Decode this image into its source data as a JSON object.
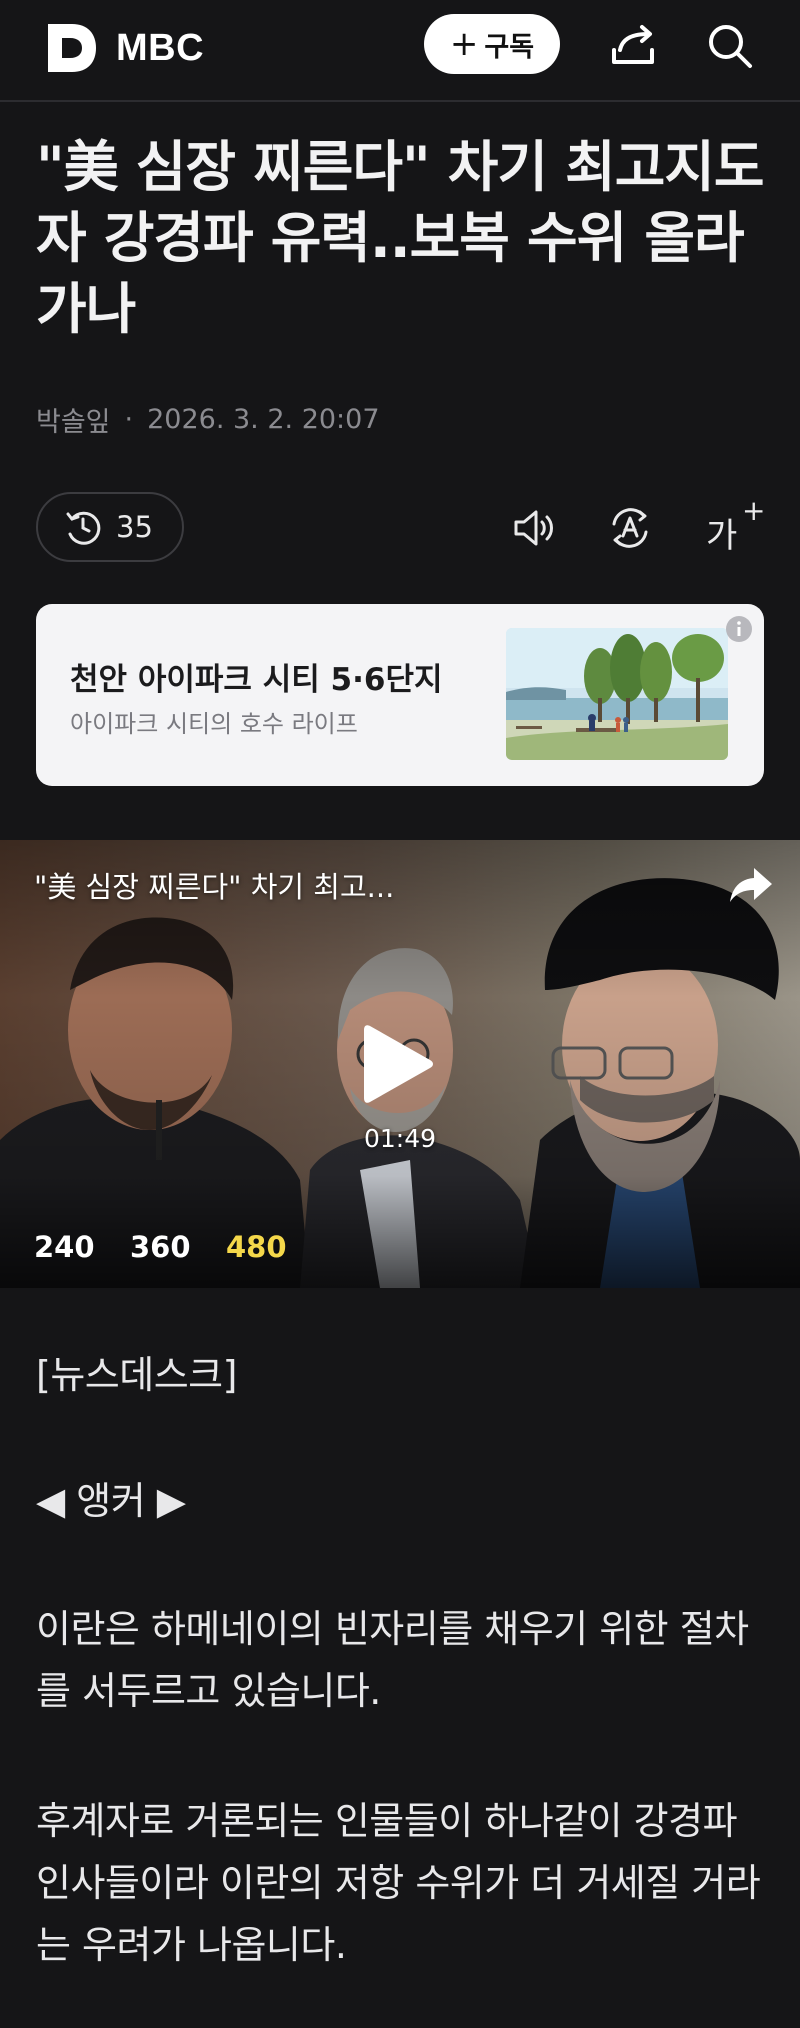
{
  "header": {
    "logo_text": "MBC",
    "subscribe_plus": "+",
    "subscribe_label": "구독",
    "icons": [
      "logo-d-icon",
      "share-icon",
      "search-icon"
    ]
  },
  "article": {
    "headline": "\"美 심장 찌른다\" 차기 최고지도자 강경파 유력..보복 수위 올라가나",
    "author": "박솔잎",
    "separator": "·",
    "datetime": "2026. 3. 2. 20:07",
    "history_count": "35",
    "font_size_label": "가",
    "font_size_plus": "+"
  },
  "ad": {
    "title": "천안 아이파크 시티 5·6단지",
    "subtitle": "아이파크 시티의 호수 라이프",
    "info_icon": "info-icon"
  },
  "video": {
    "title": "\"美 심장 찌른다\" 차기 최고...",
    "duration": "01:49",
    "qualities": [
      "240",
      "360",
      "480"
    ],
    "selected_quality": "480",
    "selected_color": "#f5d84a"
  },
  "body": {
    "tag": "[뉴스데스크]",
    "anchor": "◀ 앵커 ▶",
    "para1": "이란은 하메네이의 빈자리를 채우기 위한 절차를 서두르고 있습니다.",
    "para2": "후계자로 거론되는 인물들이 하나같이 강경파 인사들이라 이란의 저항 수위가 더 거세질 거라는 우려가 나옵니다."
  },
  "colors": {
    "background": "#151517",
    "text": "#e9e9ea",
    "muted": "#8b8b90",
    "ad_background": "#f4f4f6"
  }
}
